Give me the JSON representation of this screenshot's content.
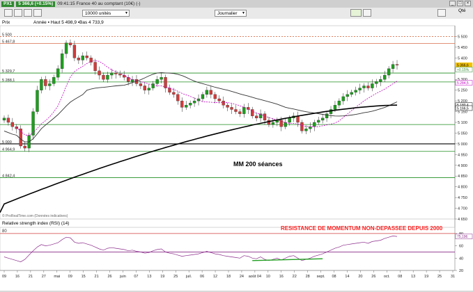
{
  "window": {
    "ticker": "PX1",
    "price_badge": "5 366,6 (+0.15%)",
    "title": "09:41:15 France 40 au comptant (10€) (-)",
    "side_label": "Qté"
  },
  "toolbar": {
    "units": "10000 unités",
    "period": "Journalier"
  },
  "main_chart": {
    "legend_label": "Prix",
    "legend_info": "Année ▪ Haut 5 498,9 ▪Bas 4 733,9",
    "source_note": "© ProRealTime.com (Données indicatives)",
    "ma_annotation": "MM 200 séances",
    "left_level_labels": [
      "5 500",
      "5 467,8",
      "5 329,7",
      "5 288,1",
      "5 000",
      "4 964,9",
      "4 842,4"
    ],
    "price_axis_ticks": [
      "5 500",
      "5 450",
      "5 400",
      "5 350",
      "5 300",
      "5 250",
      "5 200",
      "5 150",
      "5 100",
      "5 050",
      "5 000",
      "4 950",
      "4 900",
      "4 850",
      "4 800",
      "4 750",
      "4 700",
      "4 650"
    ],
    "tags": [
      {
        "text": "5 366,6",
        "color": "#f2c200"
      },
      {
        "text": "+0.15%",
        "color": "#2f8a2f"
      },
      {
        "text": "5 284,5",
        "color": "#c000c0"
      },
      {
        "text": "5 180,4",
        "color": "#000000"
      },
      {
        "text": "5 166,5",
        "color": "#000000"
      }
    ]
  },
  "rsi": {
    "legend": "Relative strength index (RSI) (14)",
    "value_tag": "75,196",
    "annotation": "RESISTANCE DE MOMENTUM NON-DEPASSEE DEPUIS 2000",
    "axis_ticks": [
      "80",
      "60",
      "40",
      "20"
    ],
    "top_label": "80",
    "levels": [
      80,
      50
    ]
  },
  "x_axis": {
    "labels": [
      "09",
      "16",
      "21",
      "27",
      "mai",
      "09",
      "15",
      "21",
      "26",
      "juin",
      "07",
      "13",
      "19",
      "25",
      "juil.",
      "06",
      "12",
      "18",
      "24",
      "août 04",
      "10",
      "16",
      "22",
      "28",
      "sept.",
      "08",
      "14",
      "20",
      "26",
      "oct.",
      "08",
      "13",
      "19",
      "25",
      "31"
    ]
  },
  "chart_data": {
    "type": "candlestick",
    "instrument": "France 40 au comptant (10€)",
    "period": "daily",
    "ylim": [
      4650,
      5550
    ],
    "horizontal_levels": [
      5500,
      5467.8,
      5329.7,
      5288.1,
      5090,
      5000,
      4964.9,
      4842.4
    ],
    "last_close": 5366.6,
    "ma_200_end": 5180.4,
    "ma_50_end": 5166.5,
    "ma_short_end": 5284.5,
    "closes": [
      5120,
      5100,
      5080,
      5070,
      4990,
      4980,
      5040,
      5150,
      5250,
      5300,
      5270,
      5280,
      5310,
      5350,
      5420,
      5470,
      5460,
      5400,
      5390,
      5410,
      5400,
      5380,
      5340,
      5320,
      5300,
      5320,
      5330,
      5325,
      5320,
      5310,
      5290,
      5300,
      5280,
      5270,
      5250,
      5260,
      5280,
      5300,
      5310,
      5260,
      5240,
      5230,
      5200,
      5170,
      5180,
      5190,
      5200,
      5210,
      5230,
      5250,
      5230,
      5210,
      5200,
      5180,
      5170,
      5160,
      5150,
      5140,
      5170,
      5160,
      5130,
      5120,
      5140,
      5110,
      5090,
      5100,
      5110,
      5080,
      5100,
      5120,
      5130,
      5100,
      5060,
      5070,
      5080,
      5100,
      5110,
      5120,
      5140,
      5160,
      5180,
      5200,
      5220,
      5230,
      5240,
      5250,
      5260,
      5270,
      5260,
      5280,
      5290,
      5300,
      5320,
      5350,
      5370,
      5366.6
    ],
    "rsi_values": [
      42,
      40,
      38,
      36,
      34,
      38,
      45,
      52,
      58,
      62,
      60,
      61,
      63,
      65,
      70,
      74,
      73,
      66,
      64,
      65,
      63,
      61,
      58,
      55,
      53,
      56,
      57,
      56,
      55,
      54,
      52,
      53,
      51,
      50,
      48,
      49,
      52,
      54,
      55,
      50,
      48,
      47,
      45,
      43,
      44,
      45,
      46,
      47,
      49,
      51,
      49,
      47,
      46,
      44,
      43,
      42,
      41,
      40,
      44,
      43,
      40,
      39,
      42,
      38,
      36,
      38,
      40,
      37,
      40,
      43,
      44,
      40,
      36,
      38,
      40,
      43,
      45,
      47,
      50,
      53,
      56,
      58,
      61,
      62,
      63,
      64,
      65,
      66,
      64,
      67,
      68,
      69,
      72,
      74,
      76,
      75.2
    ]
  }
}
